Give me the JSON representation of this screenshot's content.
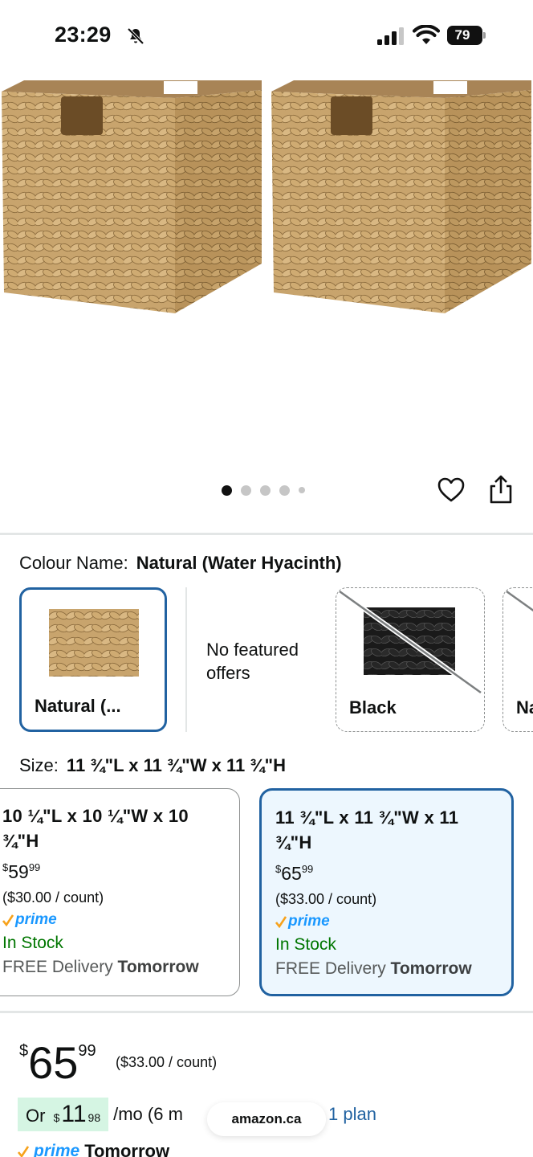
{
  "status_bar": {
    "time": "23:29",
    "battery": "79"
  },
  "gallery": {
    "dot_count": 5,
    "active_dot": 0
  },
  "colour": {
    "label": "Colour Name:",
    "value": "Natural (Water Hyacinth)",
    "options": [
      {
        "name": "Natural (...",
        "selected": true
      },
      {
        "name": "No featured offers"
      },
      {
        "name": "Black",
        "unavailable": true
      },
      {
        "name": "Na"
      }
    ]
  },
  "size": {
    "label": "Size:",
    "value": "11 ¾\"L x 11 ¾\"W x 11 ¾\"H",
    "options": [
      {
        "title": "10 ¼\"L x 10 ¼\"W x 10 ¾\"H",
        "currency": "$",
        "price_whole": "59",
        "price_cents": "99",
        "per_count": "($30.00 / count)",
        "prime": "prime",
        "stock": "In Stock",
        "delivery_prefix": "FREE Delivery",
        "delivery_day": "Tomorrow"
      },
      {
        "title": "11 ¾\"L x 11 ¾\"W x 11 ¾\"H",
        "currency": "$",
        "price_whole": "65",
        "price_cents": "99",
        "per_count": "($33.00 / count)",
        "prime": "prime",
        "stock": "In Stock",
        "delivery_prefix": "FREE Delivery",
        "delivery_day": "Tomorrow",
        "selected": true
      }
    ]
  },
  "price": {
    "currency": "$",
    "whole": "65",
    "cents": "99",
    "per_count": "($33.00 / count)"
  },
  "monthly": {
    "prefix": "Or",
    "currency": "$",
    "whole": "11",
    "cents": "98",
    "term": "/mo (6 m",
    "link": "1 plan"
  },
  "browser": {
    "url": "amazon.ca"
  },
  "delivery": {
    "prime": "prime",
    "day": "Tomorrow"
  },
  "colors": {
    "selected_border": "#2162a1",
    "selected_bg": "#edf7fe",
    "in_stock": "#007600",
    "prime_blue": "#1a98ff",
    "prime_check": "#f7a21b",
    "monthly_bg": "#d5f5e3"
  }
}
